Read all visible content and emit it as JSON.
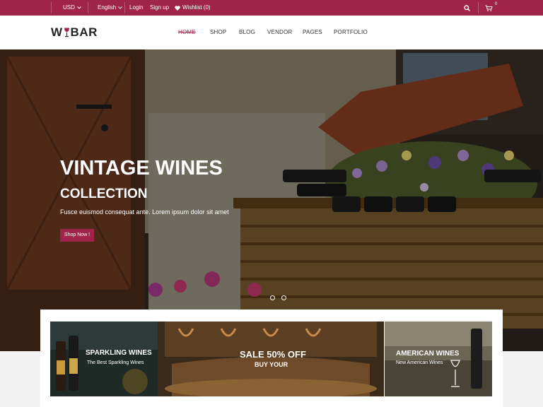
{
  "topbar": {
    "currency": "USD",
    "language": "English",
    "login": "Login",
    "signup": "Sign up",
    "wishlist": "Wishlist (0)",
    "cart_count": "0"
  },
  "header": {
    "logo_prefix": "W",
    "logo_suffix": "BAR",
    "nav": [
      "HOME",
      "SHOP",
      "BLOG",
      "VENDOR",
      "PAGES",
      "PORTFOLIO"
    ]
  },
  "hero": {
    "title": "VINTAGE WINES",
    "subtitle": "COLLECTION",
    "text": "Fusce euismod consequat ante. Lorem ipsum dolor sit amet",
    "button": "Shop Now !"
  },
  "banners": [
    {
      "title": "SPARKLING WINES",
      "subtitle": "The Best Sparkling Wines"
    },
    {
      "title": "SALE 50% OFF",
      "subtitle": "BUY YOUR"
    },
    {
      "title": "AMERICAN WINES",
      "subtitle": "New American Wines"
    }
  ],
  "colors": {
    "accent": "#a0234a"
  }
}
